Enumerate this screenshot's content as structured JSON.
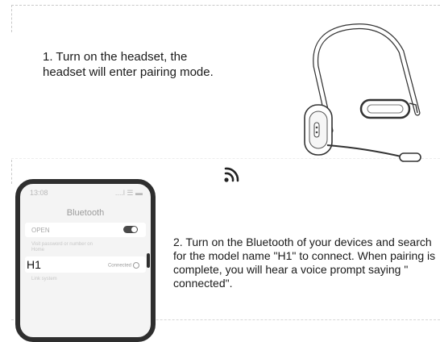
{
  "step1": {
    "text": "1. Turn on the headset, the headset will enter pairing mode."
  },
  "step2": {
    "text": "2. Turn on the Bluetooth of your devices and search for the model name \"H1\" to connect. When pairing is complete, you will hear a voice prompt saying \" connected\"."
  },
  "phone": {
    "time": "13:08",
    "signal": "....l ☰ ▬",
    "title": "Bluetooth",
    "open_label": "OPEN",
    "hint": "Visit password or number on Home",
    "device_name": "H1",
    "device_status": "Connected",
    "other_label": "Link system"
  },
  "icons": {
    "bluetooth_signal": "wireless-signal-icon",
    "info": "info-icon",
    "toggle": "toggle-switch"
  },
  "colors": {
    "text": "#1a1a1a",
    "phone_frame": "#2e2e2e",
    "toggle_on": "#4a4a4a"
  }
}
